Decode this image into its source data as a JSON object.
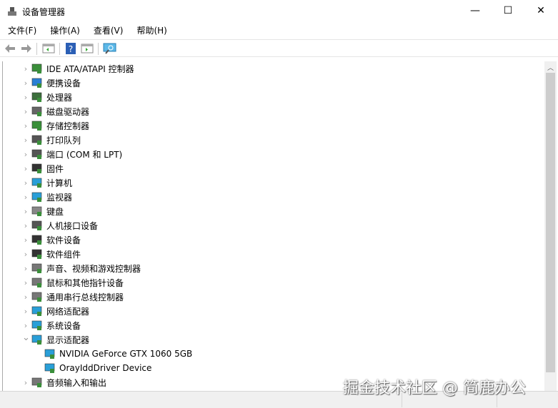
{
  "window": {
    "title": "设备管理器",
    "minimize": "—",
    "maximize": "☐",
    "close": "✕"
  },
  "menu": [
    "文件(F)",
    "操作(A)",
    "查看(V)",
    "帮助(H)"
  ],
  "toolbar": [
    "back-icon",
    "forward-icon",
    "properties-pane-icon",
    "help-icon",
    "details-pane-icon",
    "scan-hardware-icon"
  ],
  "tree": [
    {
      "label": "IDE ATA/ATAPI 控制器",
      "icon": "ide-controller-icon",
      "color": "#3a8f3a"
    },
    {
      "label": "便携设备",
      "icon": "portable-device-icon",
      "color": "#2a7fd4"
    },
    {
      "label": "处理器",
      "icon": "processor-icon",
      "color": "#3c6e3c"
    },
    {
      "label": "磁盘驱动器",
      "icon": "disk-drive-icon",
      "color": "#666"
    },
    {
      "label": "存储控制器",
      "icon": "storage-controller-icon",
      "color": "#3a8f3a"
    },
    {
      "label": "打印队列",
      "icon": "printer-icon",
      "color": "#555"
    },
    {
      "label": "端口 (COM 和 LPT)",
      "icon": "port-icon",
      "color": "#555"
    },
    {
      "label": "固件",
      "icon": "firmware-icon",
      "color": "#333"
    },
    {
      "label": "计算机",
      "icon": "computer-icon",
      "color": "#2a9fd8"
    },
    {
      "label": "监视器",
      "icon": "monitor-icon",
      "color": "#2a9fd8"
    },
    {
      "label": "键盘",
      "icon": "keyboard-icon",
      "color": "#888"
    },
    {
      "label": "人机接口设备",
      "icon": "hid-icon",
      "color": "#555"
    },
    {
      "label": "软件设备",
      "icon": "software-device-icon",
      "color": "#333"
    },
    {
      "label": "软件组件",
      "icon": "software-component-icon",
      "color": "#333"
    },
    {
      "label": "声音、视频和游戏控制器",
      "icon": "sound-icon",
      "color": "#777"
    },
    {
      "label": "鼠标和其他指针设备",
      "icon": "mouse-icon",
      "color": "#777"
    },
    {
      "label": "通用串行总线控制器",
      "icon": "usb-icon",
      "color": "#777"
    },
    {
      "label": "网络适配器",
      "icon": "network-adapter-icon",
      "color": "#2a9fd8"
    },
    {
      "label": "系统设备",
      "icon": "system-device-icon",
      "color": "#2a9fd8"
    },
    {
      "label": "显示适配器",
      "icon": "display-adapter-icon",
      "color": "#2a9fd8",
      "expanded": true
    },
    {
      "label": "NVIDIA GeForce GTX 1060 5GB",
      "icon": "display-adapter-icon",
      "color": "#2a9fd8",
      "child": true
    },
    {
      "label": "OrayIddDriver Device",
      "icon": "display-adapter-icon",
      "color": "#2a9fd8",
      "child": true
    },
    {
      "label": "音频输入和输出",
      "icon": "audio-icon",
      "color": "#777"
    }
  ],
  "watermark": "掘金技术社区 @ 简鹿办公"
}
